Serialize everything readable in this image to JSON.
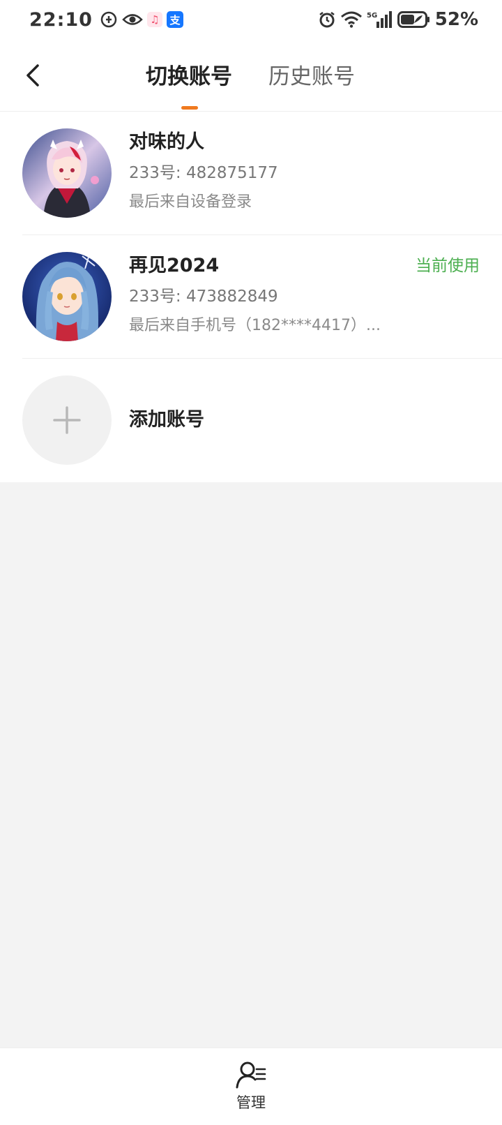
{
  "status_bar": {
    "time": "22:10",
    "battery_percent": "52%",
    "network": "5G",
    "app_icon_alipay_glyph": "支",
    "left_icons": [
      "data-saver-icon",
      "eye-icon",
      "music-app-icon",
      "alipay-icon"
    ],
    "right_icons": [
      "alarm-icon",
      "wifi-icon",
      "signal-5g-icon",
      "battery-icon"
    ]
  },
  "header": {
    "tabs": [
      {
        "label": "切换账号",
        "active": true
      },
      {
        "label": "历史账号",
        "active": false
      }
    ],
    "accent_color": "#f07a1f"
  },
  "accounts": [
    {
      "name": "对味的人",
      "id_text": "233号: 482875177",
      "login_text": "最后来自设备登录",
      "current": false,
      "avatar": "anime-avatar-pink-hair"
    },
    {
      "name": "再见2024",
      "id_text": "233号: 473882849",
      "login_text": "最后来自手机号（182****4417）...",
      "current": true,
      "current_label": "当前使用",
      "avatar": "anime-avatar-blue-hair"
    }
  ],
  "add_account": {
    "label": "添加账号"
  },
  "bottom_bar": {
    "manage_label": "管理"
  },
  "colors": {
    "current_status": "#4caf50",
    "background": "#f3f3f3"
  }
}
